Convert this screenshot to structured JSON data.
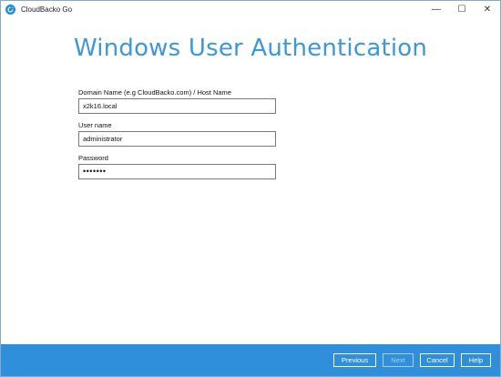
{
  "window": {
    "title": "CloudBacko Go",
    "icon": "cloudbacko-app-icon",
    "controls": {
      "minimize": "—",
      "maximize": "☐",
      "close": "✕"
    }
  },
  "page": {
    "heading": "Windows User Authentication"
  },
  "form": {
    "domain": {
      "label": "Domain Name (e.g CloudBacko.com) / Host Name",
      "value": "x2k16.local"
    },
    "username": {
      "label": "User name",
      "value": "administrator"
    },
    "password": {
      "label": "Password",
      "masked_value": "•••••••"
    }
  },
  "footer": {
    "previous": "Previous",
    "next": "Next",
    "cancel": "Cancel",
    "help": "Help"
  },
  "colors": {
    "accent": "#3d97d8",
    "footer_bg": "#2f8fdb"
  }
}
